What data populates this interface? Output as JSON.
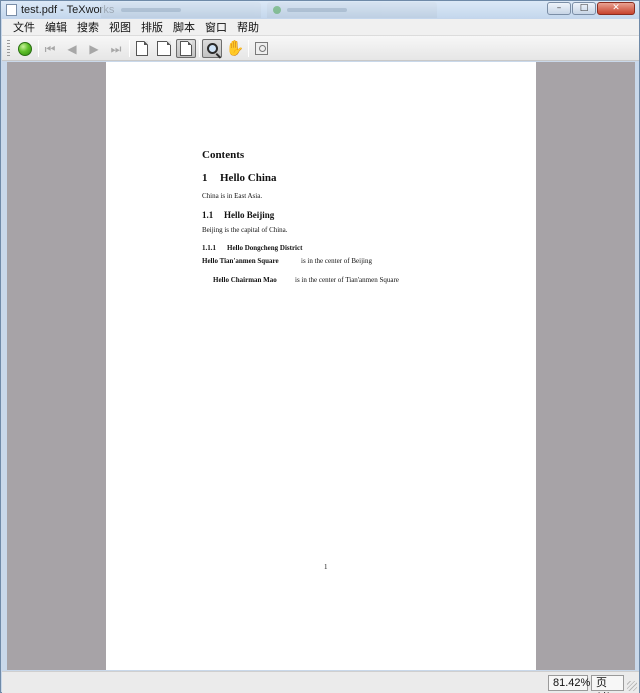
{
  "window": {
    "title": "test.pdf - TeXworks",
    "background_tabs": [
      "",
      ""
    ]
  },
  "window_controls": {
    "minimize": "–",
    "maximize": "□",
    "close": "✕"
  },
  "menu": {
    "items": [
      "文件",
      "编辑",
      "搜索",
      "视图",
      "排版",
      "脚本",
      "窗口",
      "帮助"
    ]
  },
  "toolbar": {
    "items": [
      {
        "icon": "typeset-icon"
      },
      {
        "icon": "first-page-icon"
      },
      {
        "icon": "previous-page-icon"
      },
      {
        "icon": "next-page-icon"
      },
      {
        "icon": "last-page-icon"
      },
      {
        "icon": "actual-size-icon"
      },
      {
        "icon": "fit-width-icon"
      },
      {
        "icon": "fit-window-icon",
        "checked": true
      },
      {
        "icon": "magnifier-icon",
        "checked": true
      },
      {
        "icon": "hand-scroll-icon"
      },
      {
        "icon": "find-icon"
      }
    ],
    "glyphs": {
      "first": "⏮",
      "previous": "◀",
      "next": "▶",
      "last": "⏭",
      "hand": "✋"
    }
  },
  "document": {
    "contents_heading": "Contents",
    "section": {
      "number": "1",
      "title": "Hello China",
      "body": "China is in East Asia."
    },
    "subsection": {
      "number": "1.1",
      "title": "Hello Beijing",
      "body": "Beijing is the capital of China."
    },
    "subsubsection": {
      "number": "1.1.1",
      "title": "Hello Dongcheng District"
    },
    "paragraph": {
      "head": "Hello Tian'anmen Square",
      "body": "is in the center of Beijing"
    },
    "subparagraph": {
      "head": "Hello Chairman Mao",
      "body": "is in the center of Tian'anmen Square"
    },
    "page_number": "1"
  },
  "status": {
    "zoom": "81.42%",
    "page": "页 1/1"
  },
  "colors": {
    "viewer_background": "#a7a3a7",
    "page_background": "#ffffff",
    "title_bar": "#c9d8ea"
  }
}
